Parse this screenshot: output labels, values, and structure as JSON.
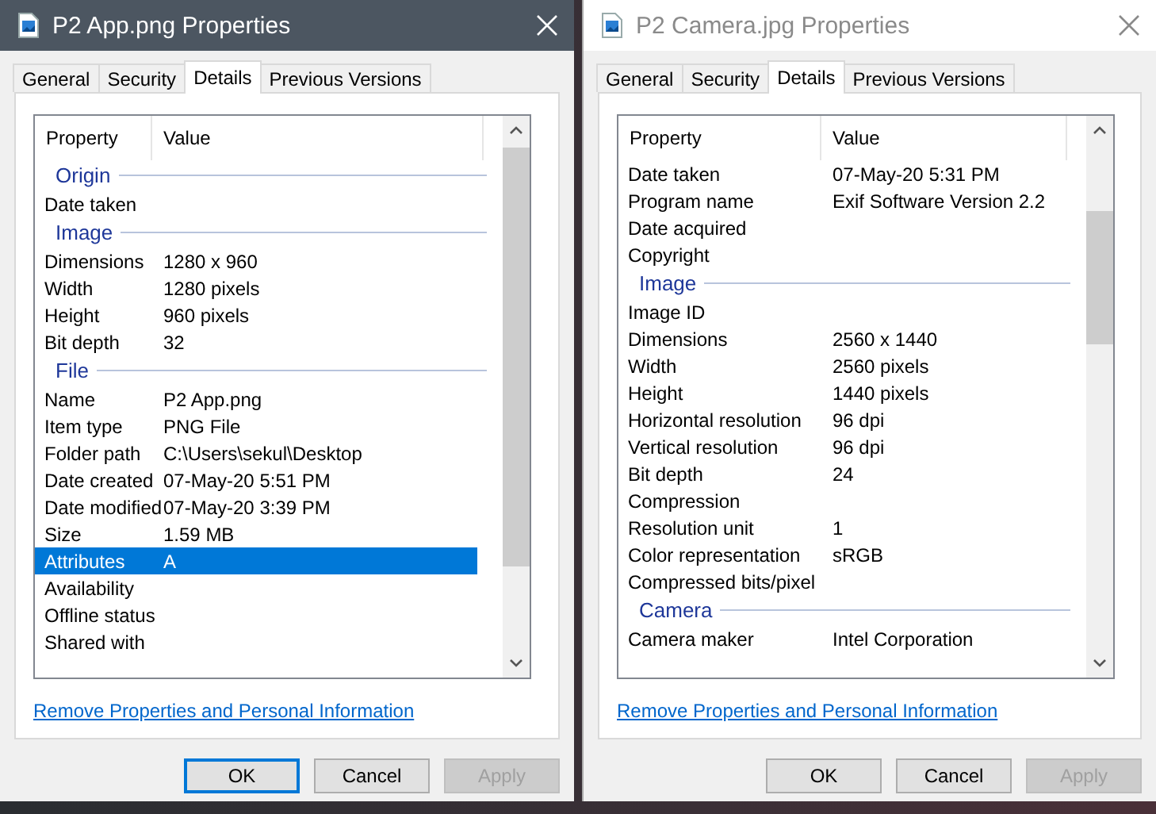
{
  "dialogs": [
    {
      "title": "P2 App.png Properties",
      "active": true,
      "tabs": [
        {
          "label": "General",
          "selected": false
        },
        {
          "label": "Security",
          "selected": false
        },
        {
          "label": "Details",
          "selected": true
        },
        {
          "label": "Previous Versions",
          "selected": false
        }
      ],
      "columns": [
        "Property",
        "Value"
      ],
      "rows": [
        {
          "kind": "group",
          "label": "Origin"
        },
        {
          "kind": "prop",
          "property": "Date taken",
          "selected": false
        },
        {
          "kind": "group",
          "label": "Image"
        },
        {
          "kind": "prop",
          "property": "Dimensions",
          "value": "1280 x 960",
          "selected": false
        },
        {
          "kind": "prop",
          "property": "Width",
          "value": "1280 pixels",
          "selected": false
        },
        {
          "kind": "prop",
          "property": "Height",
          "value": "960 pixels",
          "selected": false
        },
        {
          "kind": "prop",
          "property": "Bit depth",
          "value": "32",
          "selected": false
        },
        {
          "kind": "group",
          "label": "File"
        },
        {
          "kind": "prop",
          "property": "Name",
          "value": "P2 App.png",
          "selected": false
        },
        {
          "kind": "prop",
          "property": "Item type",
          "value": "PNG File",
          "selected": false
        },
        {
          "kind": "prop",
          "property": "Folder path",
          "value": "C:\\Users\\sekul\\Desktop",
          "selected": false
        },
        {
          "kind": "prop",
          "property": "Date created",
          "value": "07-May-20 5:51 PM",
          "selected": false
        },
        {
          "kind": "prop",
          "property": "Date modified",
          "value": "07-May-20 3:39 PM",
          "selected": false
        },
        {
          "kind": "prop",
          "property": "Size",
          "value": "1.59 MB",
          "selected": false
        },
        {
          "kind": "prop",
          "property": "Attributes",
          "value": "A",
          "selected": true
        },
        {
          "kind": "prop",
          "property": "Availability",
          "selected": false
        },
        {
          "kind": "prop",
          "property": "Offline status",
          "selected": false
        },
        {
          "kind": "prop",
          "property": "Shared with",
          "selected": false
        }
      ],
      "link": "Remove Properties and Personal Information",
      "buttons": [
        {
          "label": "OK",
          "default": true,
          "disabled": false
        },
        {
          "label": "Cancel",
          "default": false,
          "disabled": false
        },
        {
          "label": "Apply",
          "default": false,
          "disabled": true
        }
      ]
    },
    {
      "title": "P2 Camera.jpg Properties",
      "active": false,
      "tabs": [
        {
          "label": "General",
          "selected": false
        },
        {
          "label": "Security",
          "selected": false
        },
        {
          "label": "Details",
          "selected": true
        },
        {
          "label": "Previous Versions",
          "selected": false
        }
      ],
      "columns": [
        "Property",
        "Value"
      ],
      "rows": [
        {
          "kind": "prop",
          "property": "Date taken",
          "value": "07-May-20 5:31 PM",
          "selected": false
        },
        {
          "kind": "prop",
          "property": "Program name",
          "value": "Exif Software Version 2.2",
          "selected": false
        },
        {
          "kind": "prop",
          "property": "Date acquired",
          "selected": false
        },
        {
          "kind": "prop",
          "property": "Copyright",
          "selected": false
        },
        {
          "kind": "group",
          "label": "Image"
        },
        {
          "kind": "prop",
          "property": "Image ID",
          "selected": false
        },
        {
          "kind": "prop",
          "property": "Dimensions",
          "value": "2560 x 1440",
          "selected": false
        },
        {
          "kind": "prop",
          "property": "Width",
          "value": "2560 pixels",
          "selected": false
        },
        {
          "kind": "prop",
          "property": "Height",
          "value": "1440 pixels",
          "selected": false
        },
        {
          "kind": "prop",
          "property": "Horizontal resolution",
          "value": "96 dpi",
          "selected": false
        },
        {
          "kind": "prop",
          "property": "Vertical resolution",
          "value": "96 dpi",
          "selected": false
        },
        {
          "kind": "prop",
          "property": "Bit depth",
          "value": "24",
          "selected": false
        },
        {
          "kind": "prop",
          "property": "Compression",
          "selected": false
        },
        {
          "kind": "prop",
          "property": "Resolution unit",
          "value": "1",
          "selected": false
        },
        {
          "kind": "prop",
          "property": "Color representation",
          "value": "sRGB",
          "selected": false
        },
        {
          "kind": "prop",
          "property": "Compressed bits/pixel",
          "selected": false
        },
        {
          "kind": "group",
          "label": "Camera"
        },
        {
          "kind": "prop",
          "property": "Camera maker",
          "value": "Intel Corporation",
          "selected": false
        }
      ],
      "link": "Remove Properties and Personal Information",
      "buttons": [
        {
          "label": "OK",
          "default": false,
          "disabled": false
        },
        {
          "label": "Cancel",
          "default": false,
          "disabled": false
        },
        {
          "label": "Apply",
          "default": false,
          "disabled": true
        }
      ]
    }
  ]
}
